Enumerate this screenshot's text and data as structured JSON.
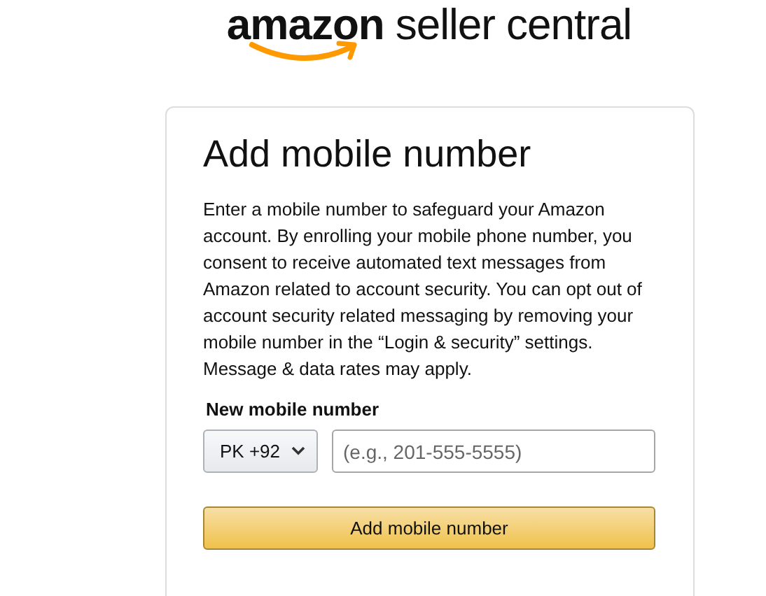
{
  "logo": {
    "brand": "amazon",
    "product": "seller central"
  },
  "heading": "Add mobile number",
  "description": "Enter a mobile number to safeguard your Amazon account. By enrolling your mobile phone number, you consent to receive automated text messages from Amazon related to account security. You can opt out of account security related messaging by removing your mobile number in the “Login & security” settings. Message & data rates may apply.",
  "field_label": "New mobile number",
  "country_select": {
    "value": "PK +92"
  },
  "phone_field": {
    "placeholder": "(e.g., 201-555-5555)"
  },
  "submit_button": "Add mobile number"
}
